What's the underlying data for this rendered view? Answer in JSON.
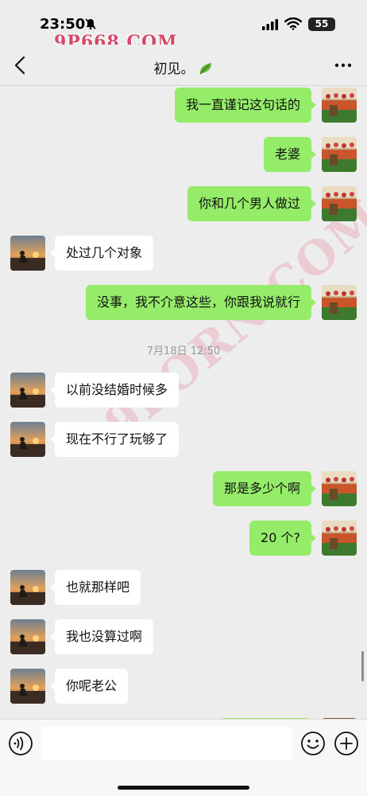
{
  "status_bar": {
    "time": "23:50",
    "battery": "55",
    "watermark": "9P668.COM"
  },
  "header": {
    "title": "初见。",
    "title_icon": "leaf-icon"
  },
  "messages": [
    {
      "side": "out",
      "text": "我一直谨记这句话的"
    },
    {
      "side": "out",
      "text": "老婆"
    },
    {
      "side": "out",
      "text": "你和几个男人做过"
    },
    {
      "side": "in",
      "text": "处过几个对象"
    },
    {
      "side": "out",
      "text": "没事，我不介意这些，你跟我说就行"
    },
    {
      "side": "in",
      "text": "以前没结婚时候多"
    },
    {
      "side": "in",
      "text": "现在不行了玩够了"
    },
    {
      "side": "out",
      "text": "那是多少个啊"
    },
    {
      "side": "out",
      "text": "20 个?"
    },
    {
      "side": "in",
      "text": "也就那样吧"
    },
    {
      "side": "in",
      "text": "我也没算过啊"
    },
    {
      "side": "in",
      "text": "你呢老公"
    }
  ],
  "timestamp": "7月18日 12:50",
  "watermark_diagonal": "9PORN.COM",
  "input": {
    "placeholder": ""
  },
  "colors": {
    "outgoing_bubble": "#95ec69",
    "incoming_bubble": "#ffffff",
    "background": "#ededed",
    "watermark": "#d44a6a"
  }
}
